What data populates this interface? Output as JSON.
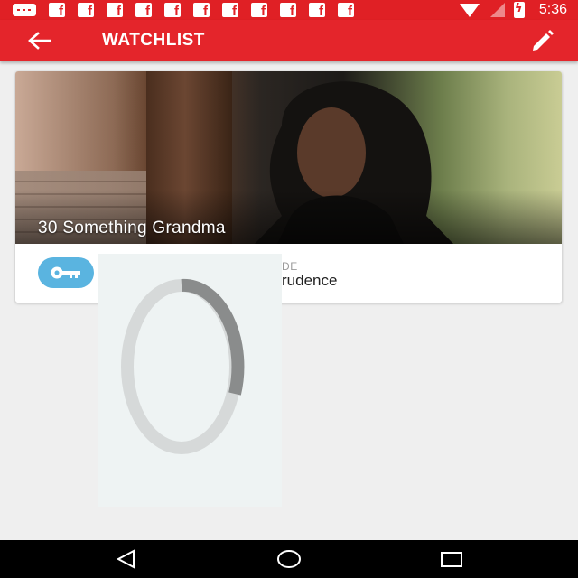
{
  "status_bar": {
    "time": "5:36",
    "icons": [
      "message-icon",
      "facebook-icon",
      "facebook-icon",
      "facebook-icon",
      "facebook-icon",
      "facebook-icon",
      "facebook-icon",
      "facebook-icon",
      "facebook-icon",
      "facebook-icon",
      "facebook-icon",
      "facebook-icon",
      "wifi-icon",
      "no-signal-icon",
      "battery-charging-icon"
    ]
  },
  "app_bar": {
    "title": "WATCHLIST",
    "back_icon": "arrow-left-icon",
    "edit_icon": "pencil-icon",
    "color": "#e4252b"
  },
  "watchlist": {
    "items": [
      {
        "show_title": "30 Something Grandma",
        "episode_label": "DE",
        "episode_title": "rudence",
        "badge_icon": "key-icon",
        "badge_color": "#5ab4e0"
      }
    ]
  },
  "loading": {
    "icon": "loading-spinner-icon"
  },
  "nav_bar": {
    "buttons": [
      "back-triangle-icon",
      "home-circle-icon",
      "recents-square-icon"
    ]
  }
}
